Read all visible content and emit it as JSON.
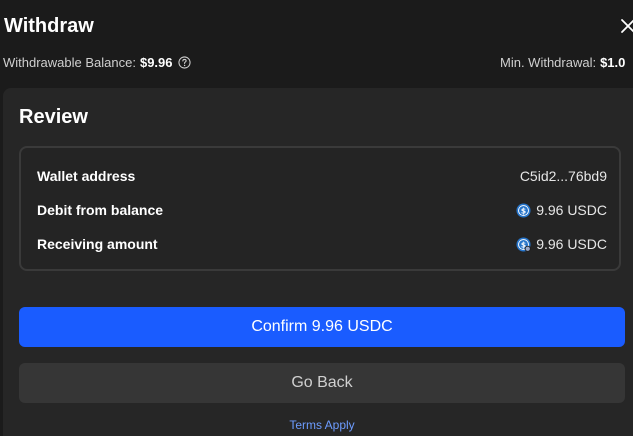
{
  "header": {
    "title": "Withdraw"
  },
  "balance": {
    "withdrawable_label": "Withdrawable Balance:",
    "withdrawable_value": "$9.96",
    "min_label": "Min. Withdrawal:",
    "min_value": "$1.0"
  },
  "review": {
    "title": "Review",
    "rows": [
      {
        "label": "Wallet address",
        "value": "C5id2...76bd9",
        "icon": null
      },
      {
        "label": "Debit from balance",
        "value": "9.96 USDC",
        "icon": "usdc-coin-icon"
      },
      {
        "label": "Receiving amount",
        "value": "9.96 USDC",
        "icon": "usdc-coin-network-icon"
      }
    ]
  },
  "actions": {
    "confirm_label": "Confirm 9.96 USDC",
    "go_back_label": "Go Back",
    "terms_label": "Terms Apply"
  },
  "colors": {
    "accent": "#1a5cff",
    "usdc": "#2775ca",
    "link": "#6d9cff"
  }
}
